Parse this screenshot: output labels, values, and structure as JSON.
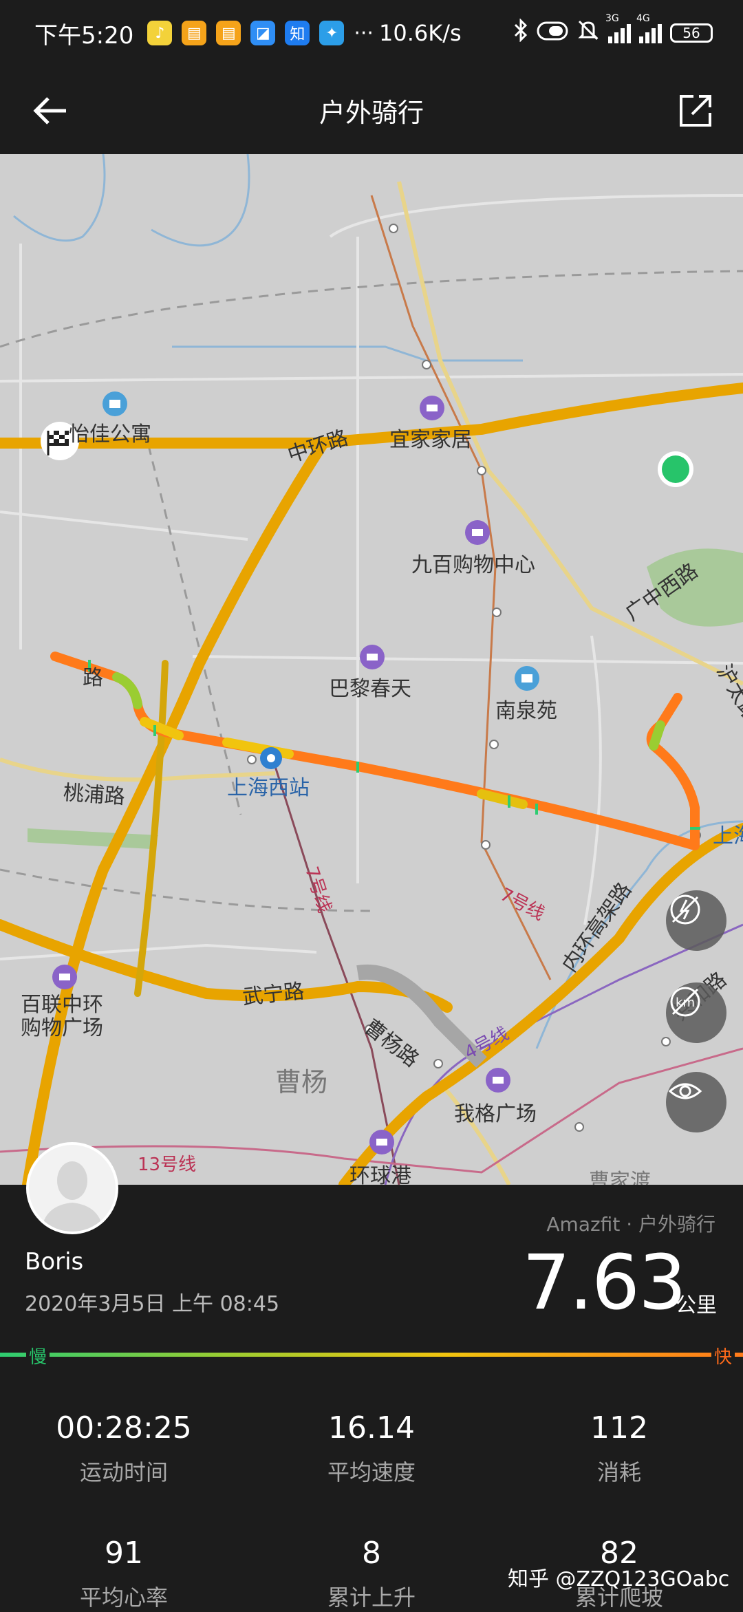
{
  "status_bar": {
    "time": "下午5:20",
    "app_icons": [
      "music-icon",
      "files-icon",
      "notes-icon",
      "browser-icon",
      "zhihu-icon",
      "bird-icon"
    ],
    "zhihu_text": "知",
    "more": "···",
    "net_speed": "10.6K/s",
    "signal_3g": "3G",
    "signal_4g": "4G",
    "battery": "56"
  },
  "header": {
    "title": "户外骑行"
  },
  "map": {
    "labels": {
      "yijia_apartment": "怡佳公寓",
      "zhonghuan_road": "中环路",
      "ikea": "宜家家居",
      "jiubai": "九百购物中心",
      "guangzhong_west": "广中西路",
      "bali_spring": "巴黎春天",
      "nanquan": "南泉苑",
      "hutai": "沪太路",
      "road_partial": "路",
      "taopu_road": "桃浦路",
      "shanghai_west": "上海西站",
      "shang_partial": "上海",
      "line7_left": "7号线",
      "line7_right": "7号线",
      "inner_ring": "内环高架路",
      "wuning_road": "武宁路",
      "bailian": "百联中环\n购物广场",
      "caoyang_road": "曹杨路",
      "line4": "4号线",
      "gonghe_partial": "共和路",
      "caoyang": "曹杨",
      "wuge_square": "我格广场",
      "line13": "13号线",
      "huanqiugang": "环球港",
      "caojiadu": "曹家渡"
    },
    "route_colors": [
      "#2ecc71",
      "#9acd32",
      "#f1c40f",
      "#ff7a1a"
    ]
  },
  "activity": {
    "user_name": "Boris",
    "datetime": "2020年3月5日 上午 08:45",
    "source": "Amazfit · 户外骑行",
    "distance": "7.63",
    "distance_unit": "公里",
    "slow_label": "慢",
    "fast_label": "快",
    "stats": [
      {
        "value": "00:28:25",
        "label": "运动时间"
      },
      {
        "value": "16.14",
        "label": "平均速度"
      },
      {
        "value": "112",
        "label": "消耗"
      },
      {
        "value": "91",
        "label": "平均心率"
      },
      {
        "value": "8",
        "label": "累计上升"
      },
      {
        "value": "82",
        "label": "累计爬坡"
      }
    ]
  },
  "watermark": "知乎 @ZZQ123GOabc"
}
